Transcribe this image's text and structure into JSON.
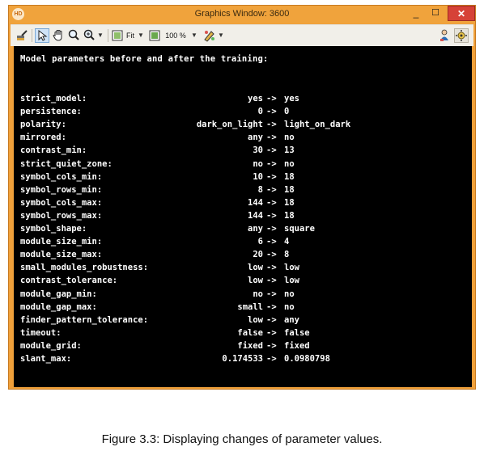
{
  "window": {
    "title": "Graphics Window: 3600",
    "app_icon_text": "HD",
    "min_label": "_",
    "max_label": "☐",
    "close_label": "✕",
    "accent_color": "#f0a03a"
  },
  "toolbar": {
    "fit_label": "Fit",
    "zoom_label": "100 %",
    "icons": [
      "paint-brush-icon",
      "pointer-icon",
      "hand-icon",
      "magnifier-icon",
      "zoom-icon",
      "fit-icon",
      "zoom-percent-icon",
      "draw-icon",
      "person-icon",
      "settings-icon"
    ]
  },
  "console": {
    "header": "Model parameters before and after the training:",
    "arrow": "->",
    "rows": [
      {
        "name": "strict_model:",
        "before": "yes",
        "after": "yes"
      },
      {
        "name": "persistence:",
        "before": "0",
        "after": "0"
      },
      {
        "name": "polarity:",
        "before": "dark_on_light",
        "after": "light_on_dark"
      },
      {
        "name": "mirrored:",
        "before": "any",
        "after": "no"
      },
      {
        "name": "contrast_min:",
        "before": "30",
        "after": "13"
      },
      {
        "name": "strict_quiet_zone:",
        "before": "no",
        "after": "no"
      },
      {
        "name": "symbol_cols_min:",
        "before": "10",
        "after": "18"
      },
      {
        "name": "symbol_rows_min:",
        "before": "8",
        "after": "18"
      },
      {
        "name": "symbol_cols_max:",
        "before": "144",
        "after": "18"
      },
      {
        "name": "symbol_rows_max:",
        "before": "144",
        "after": "18"
      },
      {
        "name": "symbol_shape:",
        "before": "any",
        "after": "square"
      },
      {
        "name": "module_size_min:",
        "before": "6",
        "after": "4"
      },
      {
        "name": "module_size_max:",
        "before": "20",
        "after": "8"
      },
      {
        "name": "small_modules_robustness:",
        "before": "low",
        "after": "low"
      },
      {
        "name": "contrast_tolerance:",
        "before": "low",
        "after": "low"
      },
      {
        "name": "module_gap_min:",
        "before": "no",
        "after": "no"
      },
      {
        "name": "module_gap_max:",
        "before": "small",
        "after": "no"
      },
      {
        "name": "finder_pattern_tolerance:",
        "before": "low",
        "after": "any"
      },
      {
        "name": "timeout:",
        "before": "false",
        "after": "false"
      },
      {
        "name": "module_grid:",
        "before": "fixed",
        "after": "fixed"
      },
      {
        "name": "slant_max:",
        "before": "0.174533",
        "after": "0.0980798"
      }
    ]
  },
  "caption": "Figure 3.3: Displaying changes of parameter values."
}
